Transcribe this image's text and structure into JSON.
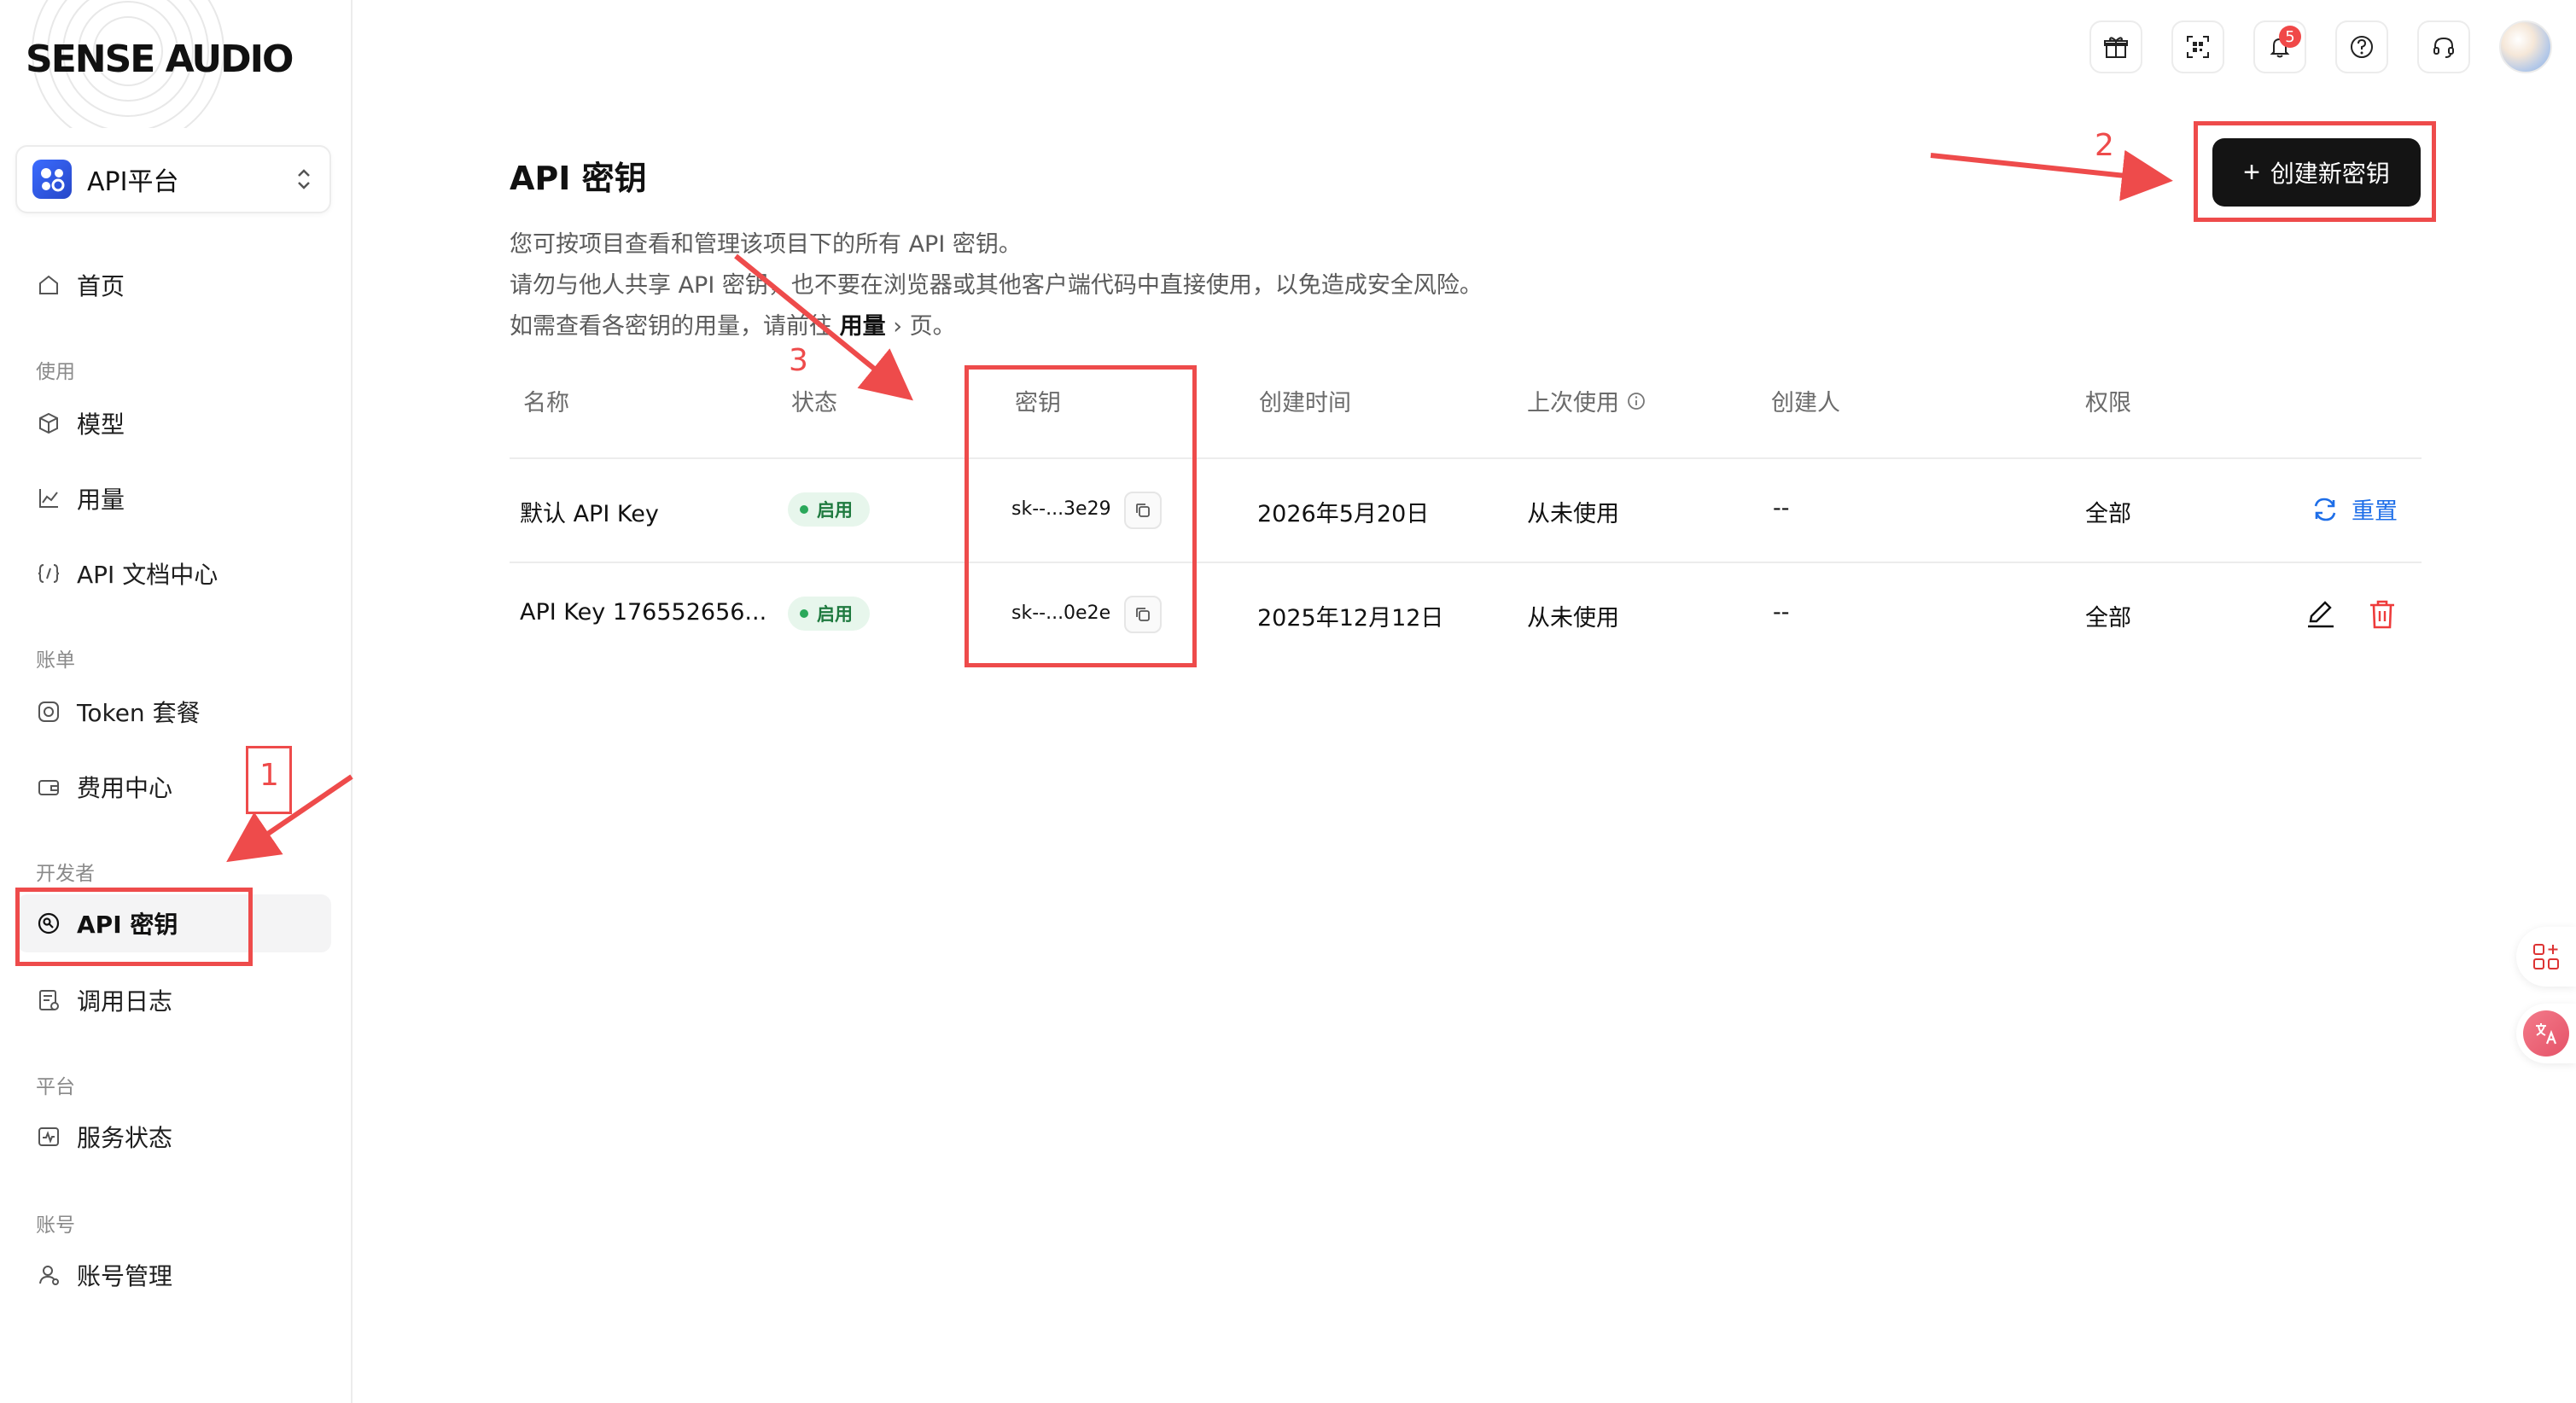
{
  "brand": {
    "logo_text": "SENSE AUDIO"
  },
  "platform_select": {
    "label": "API平台"
  },
  "sidebar": {
    "items": [
      {
        "label": "首页",
        "icon": "home-icon"
      },
      {
        "group": "使用"
      },
      {
        "label": "模型",
        "icon": "cube-icon"
      },
      {
        "label": "用量",
        "icon": "chart-line-icon"
      },
      {
        "label": "API 文档中心",
        "icon": "code-brackets-icon"
      },
      {
        "group": "账单"
      },
      {
        "label": "Token 套餐",
        "icon": "token-icon"
      },
      {
        "label": "费用中心",
        "icon": "wallet-icon"
      },
      {
        "group": "开发者"
      },
      {
        "label": "API 密钥",
        "icon": "key-icon",
        "active": true
      },
      {
        "label": "调用日志",
        "icon": "log-icon"
      },
      {
        "group": "平台"
      },
      {
        "label": "服务状态",
        "icon": "status-icon"
      },
      {
        "group": "账号"
      },
      {
        "label": "账号管理",
        "icon": "user-icon"
      }
    ]
  },
  "header": {
    "icons": [
      "gift-icon",
      "qr-scan-icon",
      "bell-icon",
      "help-icon",
      "headset-icon",
      "avatar"
    ],
    "notification_count": "5"
  },
  "main": {
    "title": "API 密钥",
    "desc_line1": "您可按项目查看和管理该项目下的所有 API 密钥。",
    "desc_line2": "请勿与他人共享 API 密钥，也不要在浏览器或其他客户端代码中直接使用，以免造成安全风险。",
    "desc_line3_prefix": "如需查看各密钥的用量，请前往",
    "desc_line3_link": "用量",
    "desc_line3_chev": "›",
    "desc_line3_suffix": "页。",
    "create_button": "创建新密钥",
    "create_button_plus": "+"
  },
  "table": {
    "headers": {
      "name": "名称",
      "status": "状态",
      "key": "密钥",
      "created": "创建时间",
      "last_used": "上次使用",
      "creator": "创建人",
      "permission": "权限"
    },
    "rows": [
      {
        "name": "默认 API Key",
        "status": "启用",
        "key": "sk--...3e29",
        "created": "2026年5月20日",
        "last_used": "从未使用",
        "creator": "--",
        "permission": "全部",
        "action": "重置"
      },
      {
        "name": "API Key 176552656...",
        "status": "启用",
        "key": "sk--...0e2e",
        "created": "2025年12月12日",
        "last_used": "从未使用",
        "creator": "--",
        "permission": "全部"
      }
    ]
  },
  "annotations": {
    "n1": "1",
    "n2": "2",
    "n3": "3"
  },
  "colors": {
    "accent": "#1e6ee8",
    "annotation": "#ee4b4b",
    "primary_button": "#141414",
    "status_green": "#2aa85a"
  }
}
